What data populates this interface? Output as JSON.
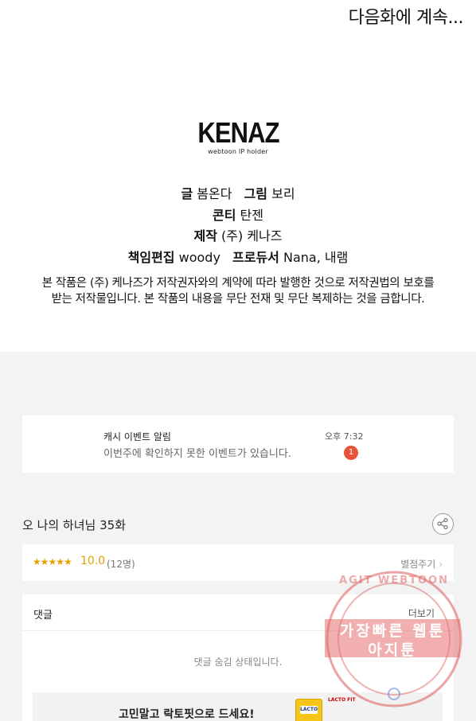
{
  "comic": {
    "continue_text": "다음화에 계속...",
    "logo_main": "KENAZ",
    "logo_sub": "webtoon IP holder",
    "credits": {
      "story_label": "글",
      "story_value": "봄온다",
      "art_label": "그림",
      "art_value": "보리",
      "storyboard_label": "콘티",
      "storyboard_value": "탄젠",
      "production_label": "제작",
      "production_value": "(주) 케나즈",
      "editor_label": "책임편집",
      "editor_value": "woody",
      "producer_label": "프로듀서",
      "producer_value": "Nana, 내램"
    },
    "notice_line1": "본 작품은 (주) 케나즈가 저작권자와의 계약에 따라 발행한 것으로 저작권법의 보호를",
    "notice_line2": "받는 저작물입니다. 본 작품의 내용을 무단 전재 및 무단 복제하는 것을 금합니다."
  },
  "notification": {
    "title": "캐시 이벤트 알림",
    "body": "이번주에 확인하지 못한 이벤트가 있습니다.",
    "time": "오후 7:32",
    "badge_count": "1"
  },
  "episode": {
    "title": "오 나의 하녀님 35화",
    "share_icon": "share-icon"
  },
  "rating": {
    "stars": "★★★★★",
    "score": "10.0",
    "count": "(12명)",
    "rate_link": "별점주기"
  },
  "comments": {
    "label": "댓글",
    "more": "더보기",
    "hidden_text": "댓글 숨김 상태입니다."
  },
  "ad": {
    "text": "고민말고 락토핏으로 드세요!",
    "product_label": "LACTO",
    "brand": "LACTO FIT"
  },
  "watermark": {
    "arc_text": "AGIT WEBTOON",
    "line1": "가장빠른 웹툰",
    "line2": "아지툰",
    "colors": {
      "stamp": "#e86e6e"
    }
  },
  "colors": {
    "accent_rating": "#e8a000",
    "badge": "#e8533a",
    "app_bg": "#f3f3f3"
  }
}
